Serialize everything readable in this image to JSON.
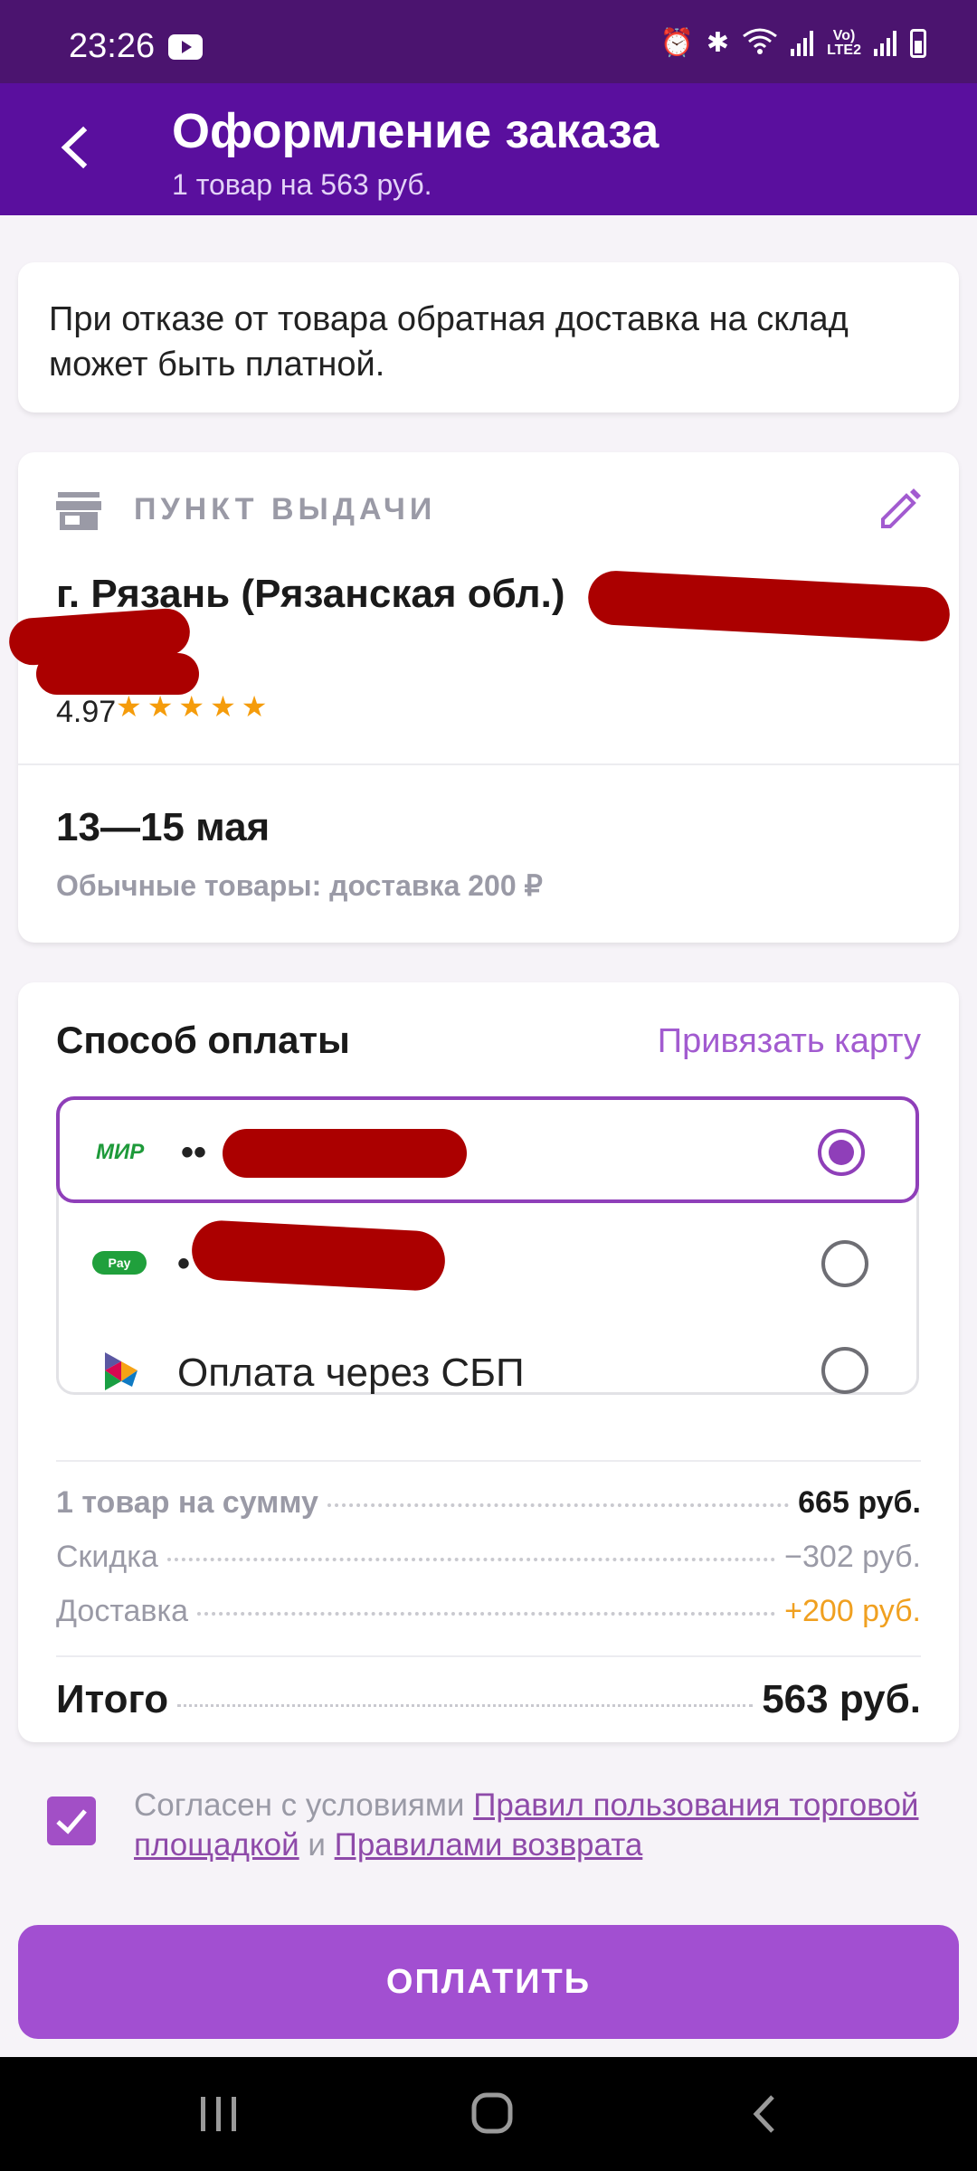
{
  "status_bar": {
    "time": "23:26",
    "network_label": "Vo)\nLTE2"
  },
  "app_bar": {
    "title": "Оформление заказа",
    "subtitle": "1 товар на 563 руб."
  },
  "notice": {
    "text": "При отказе от товара обратная доставка на склад может быть платной."
  },
  "pickup": {
    "label": "ПУНКТ ВЫДАЧИ",
    "address": "г. Рязань (Рязанская обл.)",
    "rating": "4.97",
    "stars": 5,
    "dates": "13—15 мая",
    "delivery_note": "Обычные товары: доставка 200 ₽"
  },
  "payment": {
    "title": "Способ оплаты",
    "link_card": "Привязать карту",
    "methods": [
      {
        "logo": "МИР",
        "masked": "••",
        "selected": true
      },
      {
        "logo": "Pay",
        "masked": "•",
        "selected": false
      },
      {
        "logo": "sbp-logo",
        "label": "Оплата через СБП",
        "selected": false
      }
    ]
  },
  "summary": {
    "items_label": "1 товар на сумму",
    "items_value": "665 руб.",
    "discount_label": "Скидка",
    "discount_value": "−302 руб.",
    "delivery_label": "Доставка",
    "delivery_value": "+200 руб.",
    "total_label": "Итого",
    "total_value": "563 руб."
  },
  "consent": {
    "prefix": "Согласен с условиями",
    "link1": "Правил пользования торговой площадкой",
    "middle": "и",
    "link2": "Правилами возврата",
    "checked": true
  },
  "pay_button": {
    "label": "ОПЛАТИТЬ"
  },
  "colors": {
    "header": "#5a0f9e",
    "accent": "#a24fd1",
    "rating_star": "#f59c0b",
    "delivery_surcharge": "#f0a020"
  }
}
